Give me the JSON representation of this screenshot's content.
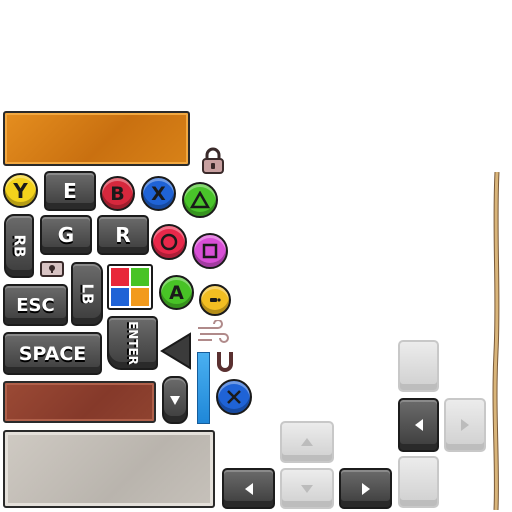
{
  "keys": {
    "e": "E",
    "g": "G",
    "r": "R",
    "esc": "ESC",
    "space": "SPACE",
    "enter": "ENTER",
    "rb": "RB",
    "lb": "LB"
  },
  "buttons": {
    "y": "Y",
    "b": "B",
    "x": "X",
    "a": "A"
  },
  "colors": {
    "y_button": "#f3d21c",
    "b_button": "#d6283d",
    "x_button": "#1f63d6",
    "a_button": "#48c326",
    "ps_triangle": "#49c42a",
    "ps_circle": "#e8284a",
    "ps_square": "#d84fd6",
    "ps_cross": "#1f63d6",
    "hint_yellow": "#f2be22",
    "blue_bar": "#1f87d8",
    "rope": "#d9b57a"
  },
  "icons": [
    "lock-icon",
    "small-lock-icon",
    "exclamation-icon",
    "wind-icon",
    "magnet-icon",
    "arrow-left-icon",
    "arrow-down-icon",
    "gamepad-grid-icon"
  ]
}
